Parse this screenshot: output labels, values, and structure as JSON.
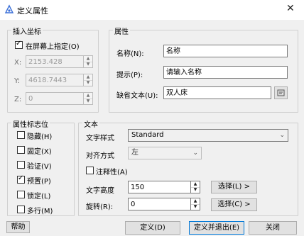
{
  "window": {
    "title": "定义属性",
    "close_glyph": "✕",
    "app_icon": "attribute-icon"
  },
  "insert_point": {
    "group_label": "插入坐标",
    "on_screen_checkbox": {
      "label": "在屏幕上指定(O)",
      "checked": true
    },
    "x_label": "X:",
    "x_value": "2153.428",
    "y_label": "Y:",
    "y_value": "4618.7443",
    "z_label": "Z:",
    "z_value": "0"
  },
  "attribute": {
    "group_label": "属性",
    "tag_label": "名称(N):",
    "tag_value": "名称",
    "prompt_label": "提示(P):",
    "prompt_value": "请输入名称",
    "default_label": "缺省文本(U):",
    "default_value": "双人床",
    "field_button_icon": "insert-field-icon"
  },
  "modes": {
    "group_label": "属性标志位",
    "items": [
      {
        "label": "隐藏(H)",
        "checked": false
      },
      {
        "label": "固定(X)",
        "checked": false
      },
      {
        "label": "验证(V)",
        "checked": false
      },
      {
        "label": "预置(P)",
        "checked": true
      },
      {
        "label": "锁定(L)",
        "checked": false
      },
      {
        "label": "多行(M)",
        "checked": false
      }
    ]
  },
  "text": {
    "group_label": "文本",
    "style_label": "文字样式",
    "style_value": "Standard",
    "justify_label": "对齐方式",
    "justify_value": "左",
    "annotative": {
      "label": "注释性(A)",
      "checked": false
    },
    "height_label": "文字高度",
    "height_value": "150",
    "height_pick_button": "选择(L) >",
    "rotation_label": "旋转(R):",
    "rotation_value": "0",
    "rotation_pick_button": "选择(C) >"
  },
  "footer": {
    "help": "帮助",
    "define": "定义(D)",
    "define_exit": "定义并退出(E)",
    "close": "关闭"
  },
  "colors": {
    "accent": "#0078d7",
    "window_bg": "#f0f0f0"
  }
}
